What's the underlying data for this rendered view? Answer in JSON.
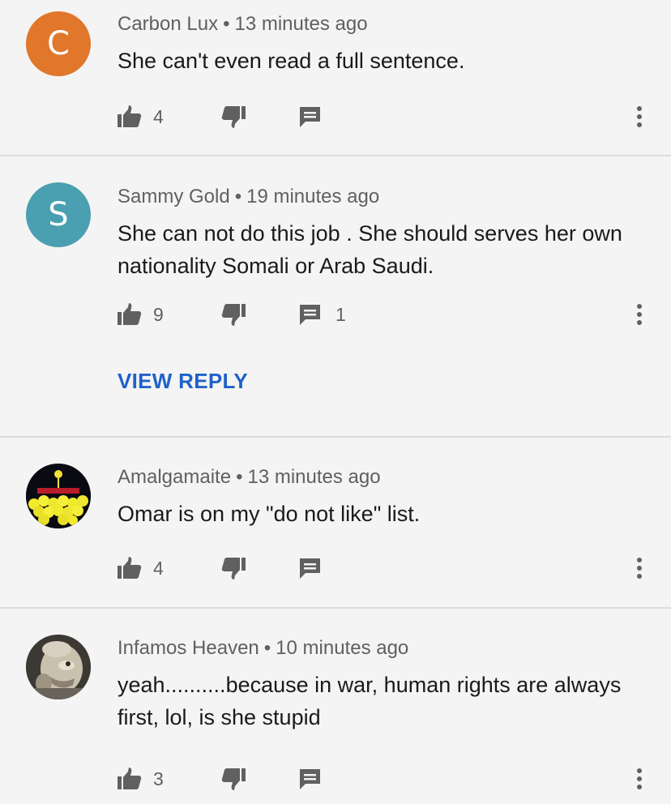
{
  "comments": [
    {
      "author": "Carbon Lux",
      "separator": "•",
      "time": "13 minutes ago",
      "text": "She can't even read a full sentence.",
      "likes": "4",
      "replies": "",
      "avatar": {
        "letter": "C",
        "color": "#e0772b"
      }
    },
    {
      "author": "Sammy Gold",
      "separator": "•",
      "time": "19 minutes ago",
      "text": "She can not do this job . She should serves her own nationality Somali or Arab Saudi.",
      "likes": "9",
      "replies": "1",
      "view_reply_label": "VIEW REPLY",
      "avatar": {
        "letter": "S",
        "color": "#4a9fb0"
      }
    },
    {
      "author": "Amalgamaite",
      "separator": "•",
      "time": "13 minutes ago",
      "text": "Omar is on my \"do not like\" list.",
      "likes": "4",
      "replies": "",
      "avatar": {
        "icon": "emoji-crowd-avatar"
      }
    },
    {
      "author": "Infamos Heaven",
      "separator": "•",
      "time": "10 minutes ago",
      "text": "yeah..........because in war, human rights are always first, lol, is she stupid",
      "likes": "3",
      "replies": "",
      "avatar": {
        "icon": "creature-avatar"
      }
    }
  ],
  "icons": {
    "like": "thumbs-up-icon",
    "dislike": "thumbs-down-icon",
    "reply": "reply-comment-icon",
    "more": "more-vertical-icon"
  },
  "colors": {
    "background": "#f4f4f4",
    "link": "#1f61c9",
    "icon": "#606060"
  }
}
